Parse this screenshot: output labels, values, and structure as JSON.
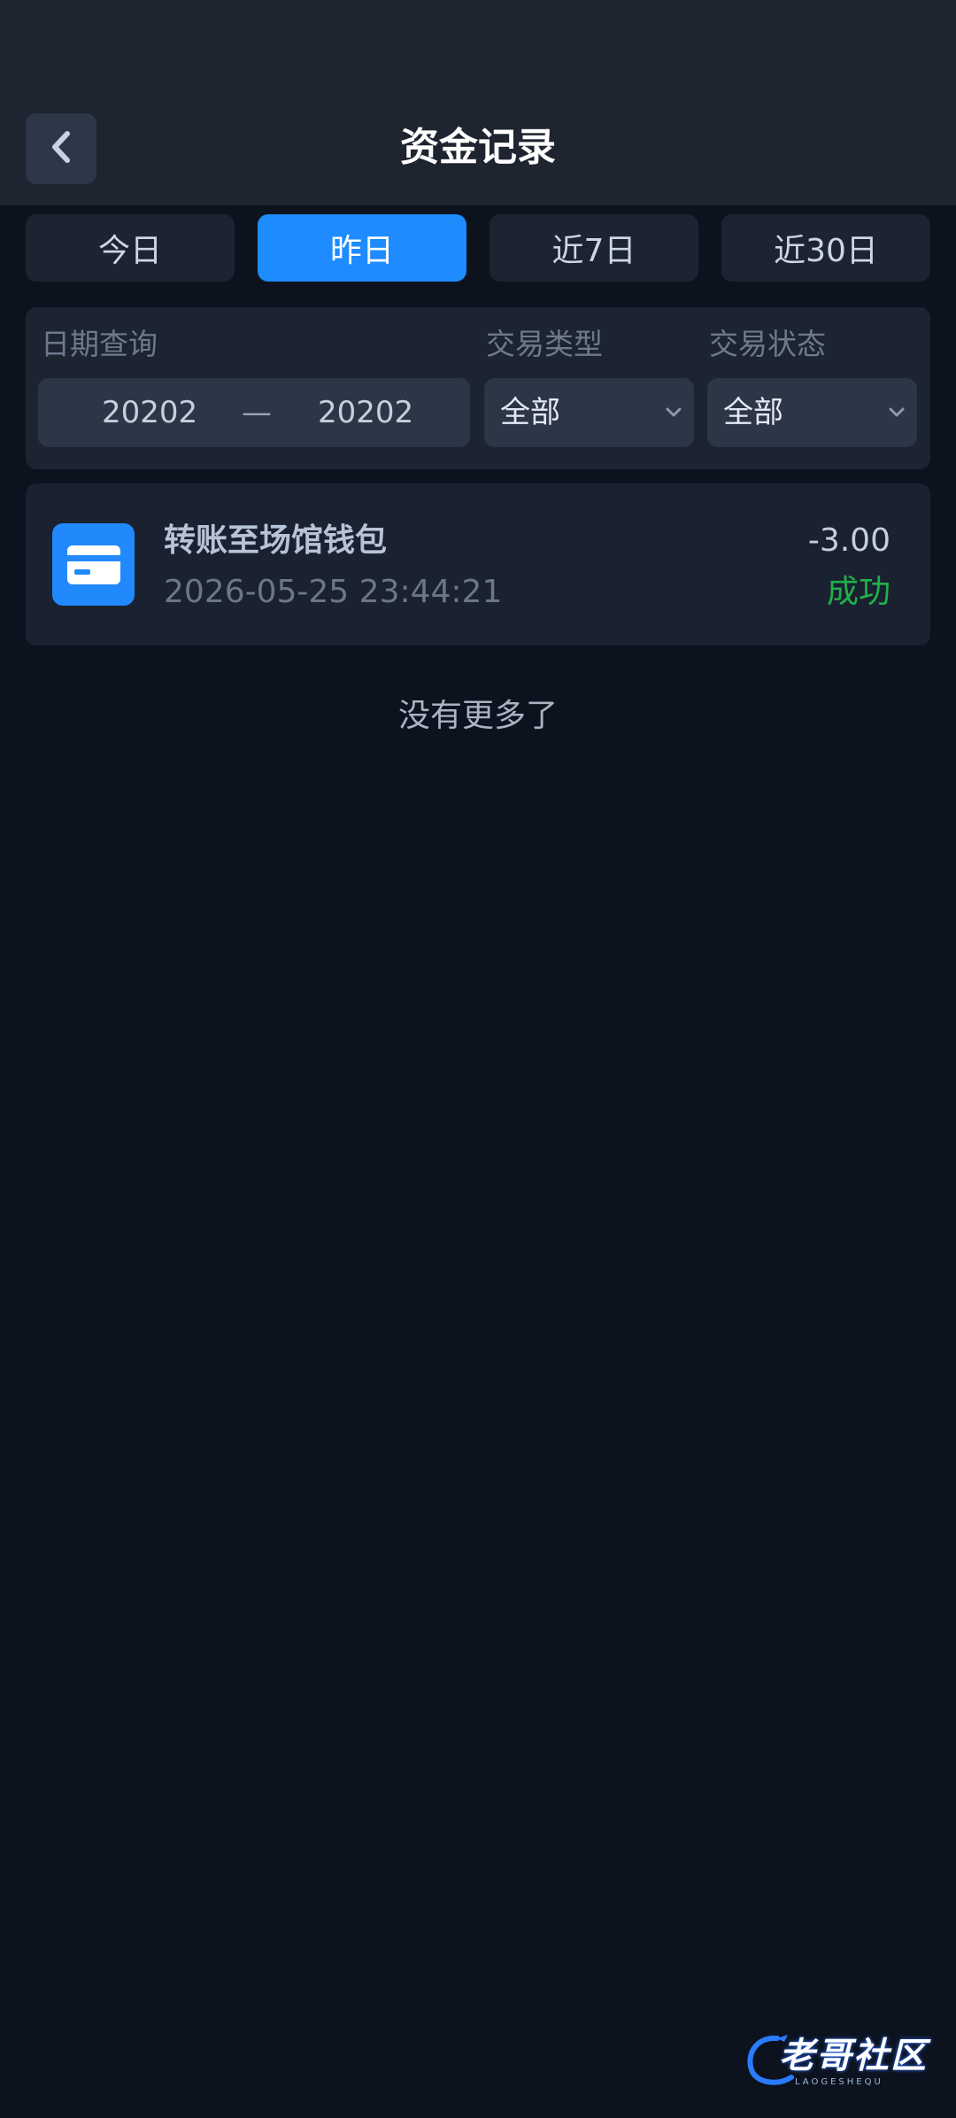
{
  "header": {
    "title": "资金记录",
    "back_icon": "chevron-left-icon"
  },
  "tabs": [
    {
      "label": "今日",
      "active": false
    },
    {
      "label": "昨日",
      "active": true
    },
    {
      "label": "近7日",
      "active": false
    },
    {
      "label": "近30日",
      "active": false
    }
  ],
  "filter": {
    "date_label": "日期查询",
    "date_start": "20202",
    "date_separator": "—",
    "date_end": "20202",
    "type_label": "交易类型",
    "type_value": "全部",
    "status_label": "交易状态",
    "status_value": "全部"
  },
  "records": [
    {
      "icon": "card-icon",
      "title": "转账至场馆钱包",
      "time": "2026-05-25 23:44:21",
      "amount": "-3.00",
      "status": "成功"
    }
  ],
  "no_more": "没有更多了",
  "watermark": {
    "text": "老哥社区",
    "sub": "LAOGESHEQU"
  },
  "colors": {
    "background": "#0c131e",
    "accent": "#1e8bff",
    "success": "#20b14a"
  }
}
